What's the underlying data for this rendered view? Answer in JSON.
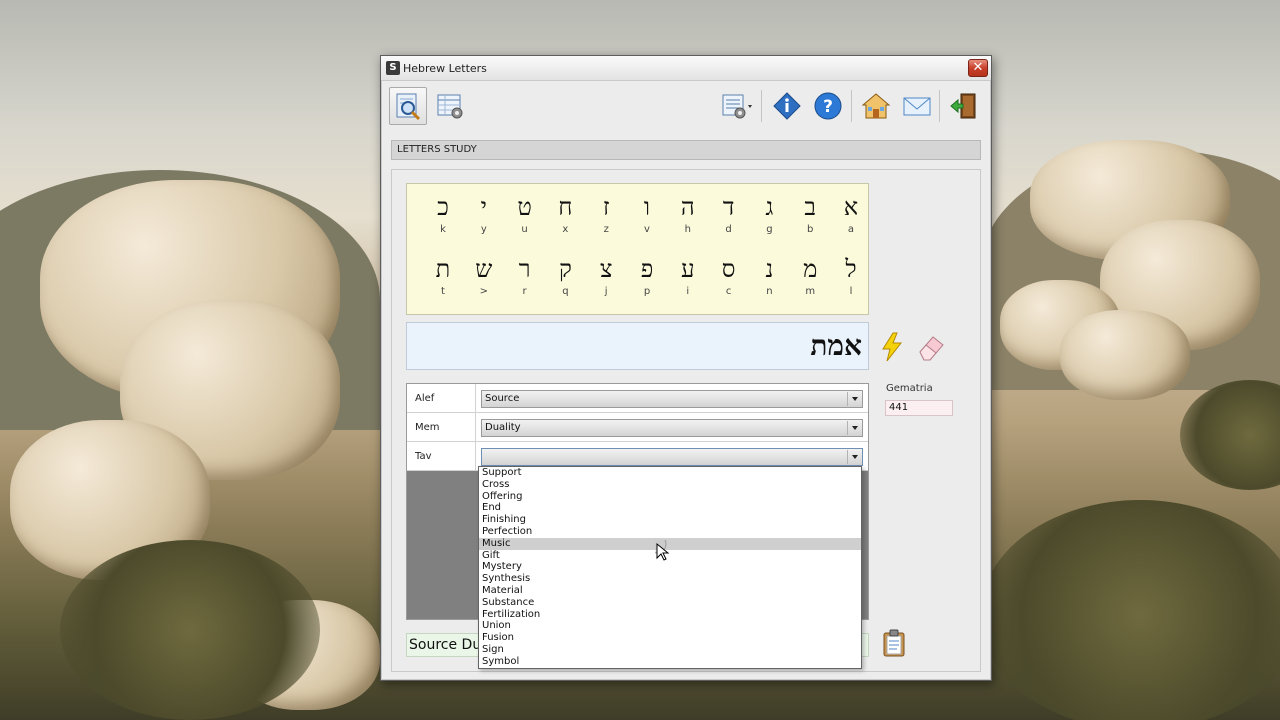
{
  "window": {
    "title": "Hebrew Letters",
    "close": "✕"
  },
  "toolbar": {
    "buttons": [
      {
        "name": "study-button",
        "icon": "magnifier-document-icon"
      },
      {
        "name": "table-settings-button",
        "icon": "table-gear-icon"
      },
      {
        "name": "columns-menu-button",
        "icon": "list-gear-icon"
      },
      {
        "name": "info-button",
        "icon": "info-diamond-icon"
      },
      {
        "name": "help-button",
        "icon": "help-circle-icon"
      },
      {
        "name": "home-button",
        "icon": "home-icon"
      },
      {
        "name": "mail-button",
        "icon": "mail-icon"
      },
      {
        "name": "exit-button",
        "icon": "exit-door-icon"
      }
    ]
  },
  "section": {
    "header": "LETTERS STUDY"
  },
  "letters": {
    "row1": [
      {
        "heb": "א",
        "lat": "a"
      },
      {
        "heb": "ב",
        "lat": "b"
      },
      {
        "heb": "ג",
        "lat": "g"
      },
      {
        "heb": "ד",
        "lat": "d"
      },
      {
        "heb": "ה",
        "lat": "h"
      },
      {
        "heb": "ו",
        "lat": "v"
      },
      {
        "heb": "ז",
        "lat": "z"
      },
      {
        "heb": "ח",
        "lat": "x"
      },
      {
        "heb": "ט",
        "lat": "u"
      },
      {
        "heb": "י",
        "lat": "y"
      },
      {
        "heb": "כ",
        "lat": "k"
      }
    ],
    "row2": [
      {
        "heb": "ל",
        "lat": "l"
      },
      {
        "heb": "מ",
        "lat": "m"
      },
      {
        "heb": "נ",
        "lat": "n"
      },
      {
        "heb": "ס",
        "lat": "c"
      },
      {
        "heb": "ע",
        "lat": "i"
      },
      {
        "heb": "פ",
        "lat": "p"
      },
      {
        "heb": "צ",
        "lat": "j"
      },
      {
        "heb": "ק",
        "lat": "q"
      },
      {
        "heb": "ר",
        "lat": "r"
      },
      {
        "heb": "ש",
        "lat": ">"
      },
      {
        "heb": "ת",
        "lat": "t"
      }
    ]
  },
  "word": {
    "text": "אמת"
  },
  "actions": {
    "compute_icon": "lightning-icon",
    "clear_icon": "eraser-icon",
    "copy_icon": "clipboard-icon"
  },
  "gematria": {
    "label": "Gematria",
    "value": "441"
  },
  "associations": [
    {
      "letter": "Alef",
      "selected": "Source"
    },
    {
      "letter": "Mem",
      "selected": "Duality"
    },
    {
      "letter": "Tav",
      "selected": ""
    }
  ],
  "result_line": "Source Duality",
  "dropdown": {
    "highlighted": "Music",
    "options": [
      "Support",
      "Cross",
      "Offering",
      "End",
      "Finishing",
      "Perfection",
      "Music",
      "Gift",
      "Mystery",
      "Synthesis",
      "Material",
      "Substance",
      "Fertilization",
      "Union",
      "Fusion",
      "Sign",
      " Symbol"
    ]
  }
}
